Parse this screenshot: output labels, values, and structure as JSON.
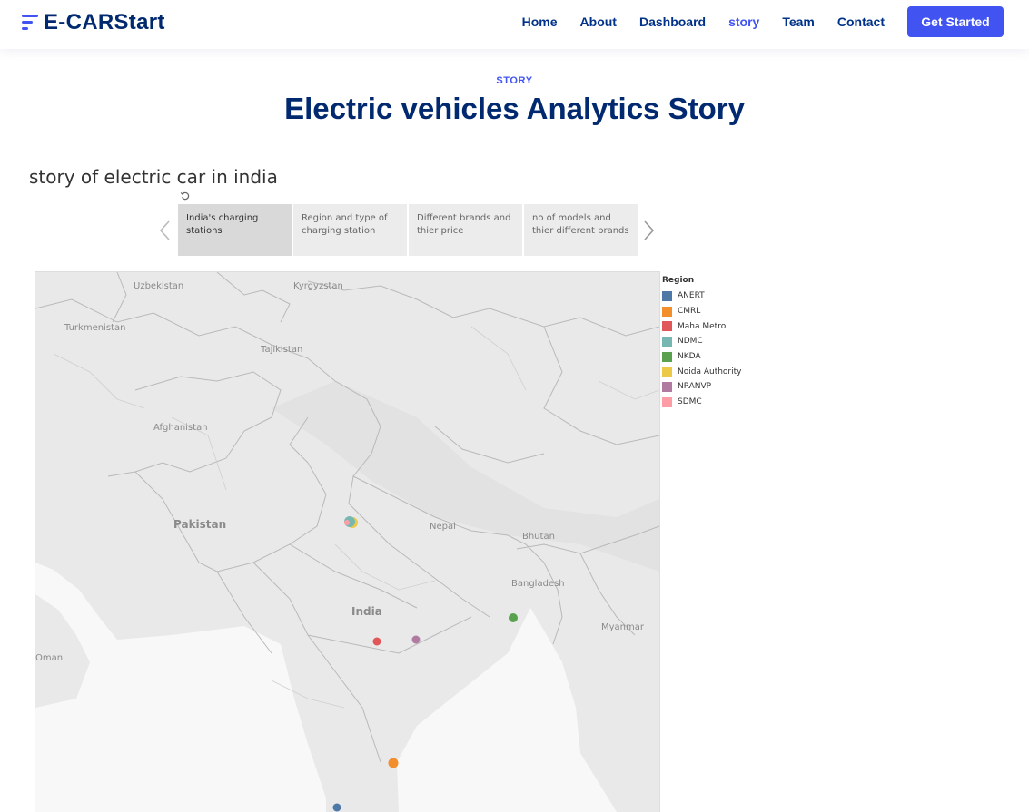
{
  "header": {
    "brand": "E-CARStart",
    "nav": [
      {
        "label": "Home",
        "active": false
      },
      {
        "label": "About",
        "active": false
      },
      {
        "label": "Dashboard",
        "active": false
      },
      {
        "label": "story",
        "active": true
      },
      {
        "label": "Team",
        "active": false
      },
      {
        "label": "Contact",
        "active": false
      }
    ],
    "cta_label": "Get Started",
    "accent_color": "#4154f1"
  },
  "section": {
    "tag": "STORY",
    "title": "Electric vehicles Analytics Story"
  },
  "story": {
    "title": "story of electric car in india",
    "tabs": [
      {
        "label": "India's charging stations",
        "active": true
      },
      {
        "label": "Region and type of charging station",
        "active": false
      },
      {
        "label": "Different brands and thier price",
        "active": false
      },
      {
        "label": "no of models and thier different brands",
        "active": false
      }
    ]
  },
  "map": {
    "labels": [
      "Uzbekistan",
      "Kyrgyzstan",
      "Turkmenistan",
      "Tajikistan",
      "Afghanistan",
      "Pakistan",
      "Nepal",
      "Bhutan",
      "Bangladesh",
      "India",
      "Myanmar",
      "Oman"
    ]
  },
  "legend": {
    "title": "Region",
    "items": [
      {
        "label": "ANERT",
        "color": "#4e79a7"
      },
      {
        "label": "CMRL",
        "color": "#f28e2b"
      },
      {
        "label": "Maha Metro",
        "color": "#e15759"
      },
      {
        "label": "NDMC",
        "color": "#76b7b2"
      },
      {
        "label": "NKDA",
        "color": "#59a14f"
      },
      {
        "label": "Noida Authority",
        "color": "#edc948"
      },
      {
        "label": "NRANVP",
        "color": "#b07aa1"
      },
      {
        "label": "SDMC",
        "color": "#ff9da7"
      }
    ]
  }
}
